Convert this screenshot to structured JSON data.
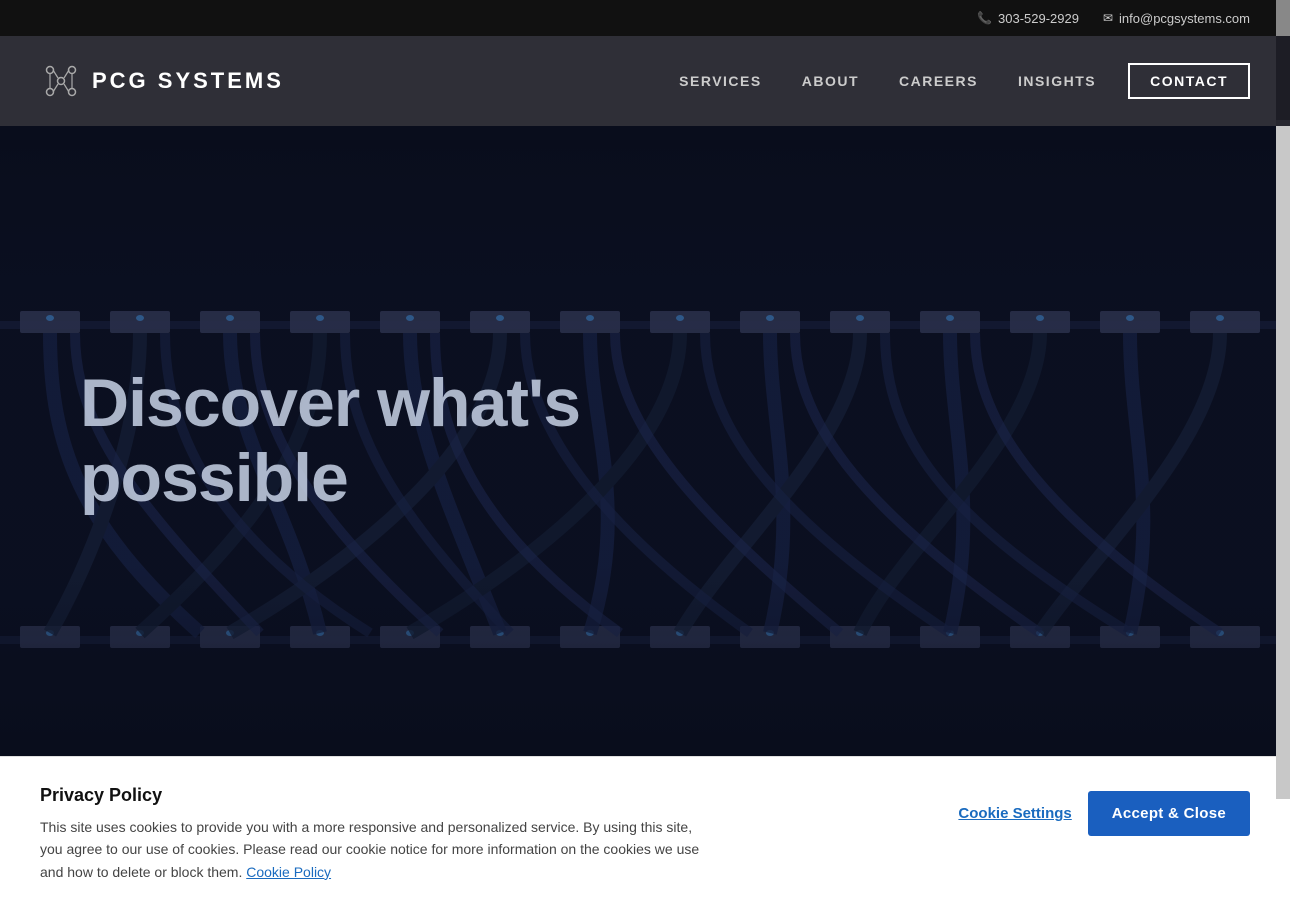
{
  "topbar": {
    "phone": "303-529-2929",
    "email": "info@pcgsystems.com"
  },
  "header": {
    "logo_text": "PCG SYSTEMS",
    "nav": {
      "services": "SERVICES",
      "about": "ABOUT",
      "careers": "CAREERS",
      "insights": "INSIGHTS",
      "contact": "CONTACT"
    }
  },
  "hero": {
    "title_line1": "Discover what's",
    "title_line2": "possible"
  },
  "cookie": {
    "title": "Privacy Policy",
    "description": "This site uses cookies to provide you with a more responsive and personalized service. By using this site, you agree to our use of cookies. Please read our cookie notice for more information on the cookies we use and how to delete or block them.",
    "link_text": "Cookie Policy",
    "settings_label": "Cookie Settings",
    "accept_label": "Accept & Close"
  },
  "icons": {
    "phone": "📞",
    "email": "✉"
  }
}
